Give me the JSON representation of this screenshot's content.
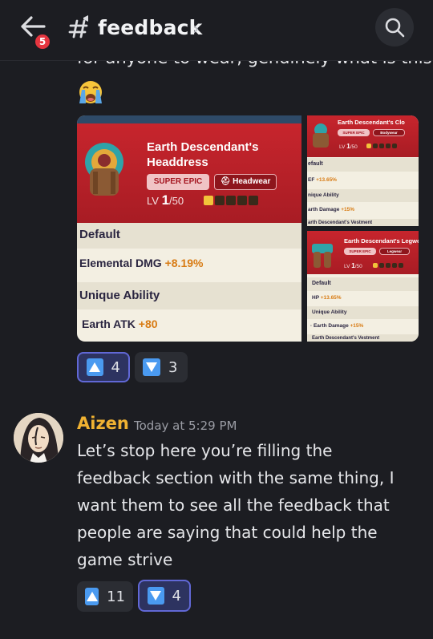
{
  "header": {
    "back_icon": "arrow-left-icon",
    "unread_badge": "5",
    "channel_icon": "hash-announcement-icon",
    "channel_name": "feedback",
    "channel_chevron": "›",
    "search_icon": "search-icon"
  },
  "message1": {
    "continuation_text": "for anyone to wear, genuinely what is this",
    "emoji": "loudly-crying-face",
    "attachments": [
      {
        "title_line1": "Earth Descendant's",
        "title_line2": "Headdress",
        "rarity": "SUPER EPIC",
        "slot": "Headwear",
        "level_prefix": "LV",
        "level": "1",
        "level_max": "/50",
        "rows": [
          {
            "label": "Default",
            "value": ""
          },
          {
            "label": "Elemental DMG",
            "value": "+8.19%"
          },
          {
            "label": "Unique Ability",
            "value": ""
          },
          {
            "label": "Earth ATK",
            "value": "+80"
          }
        ]
      },
      {
        "title": "Earth Descendant's Clo",
        "rarity": "SUPER EPIC",
        "slot": "Bodywear",
        "level_prefix": "LV",
        "level": "1",
        "level_max": "/50",
        "rows": [
          {
            "label": "efault",
            "value": ""
          },
          {
            "label": "EF",
            "value": "+13.65%"
          },
          {
            "label": "nique Ability",
            "value": ""
          },
          {
            "label": "arth Damage",
            "value": "+15%"
          },
          {
            "label": "arth Descendant's Vestment",
            "value": ""
          }
        ]
      },
      {
        "title": "Earth Descendant's Legwe",
        "rarity": "SUPER EPIC",
        "slot": "Legwear",
        "level_prefix": "LV",
        "level": "1",
        "level_max": "/50",
        "rows": [
          {
            "label": "Default",
            "value": ""
          },
          {
            "label": "HP",
            "value": "+13.65%"
          },
          {
            "label": "Unique Ability",
            "value": ""
          },
          {
            "label": "· Earth Damage",
            "value": "+15%"
          },
          {
            "label": "Earth Descendant's Vestment",
            "value": ""
          }
        ]
      }
    ],
    "reactions": [
      {
        "icon": "arrow-up-box-icon",
        "count": "4",
        "active": true
      },
      {
        "icon": "arrow-down-box-icon",
        "count": "3",
        "active": false
      }
    ]
  },
  "message2": {
    "author": "Aizen",
    "timestamp": "Today at 5:29 PM",
    "lines": [
      "Let’s stop here you’re filling the",
      "feedback section with the same thing, I",
      "want them to see all the feedback that",
      "people are saying that could help the",
      "game strive"
    ],
    "reactions": [
      {
        "icon": "arrow-up-box-icon",
        "count": "11",
        "active": false
      },
      {
        "icon": "arrow-down-box-icon",
        "count": "4",
        "active": true
      }
    ]
  },
  "colors": {
    "background": "#1c1d22",
    "author_name": "#f0b232",
    "badge": "#e5353f",
    "reaction_active_border": "#6168d6",
    "arrow_box": "#4a9af0",
    "card_red": "#c7252d",
    "stat_value": "#d87b13"
  }
}
